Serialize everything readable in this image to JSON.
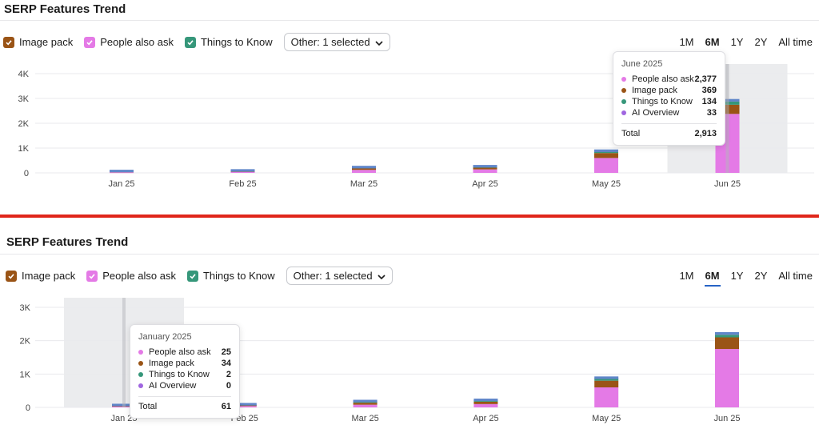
{
  "colors": {
    "image_pack": "#9a5416",
    "people_also_ask": "#e47ae6",
    "things_to_know": "#36977a",
    "ai_overview": "#a066e0",
    "top_cap": "#5f86c9",
    "highlight": "#ebecee",
    "grid": "#e9eaed",
    "active_range": "#2764c6",
    "divider": "#e0261a"
  },
  "panels": [
    {
      "title": "SERP Features Trend",
      "legend": [
        {
          "label": "Image pack",
          "color": "#9a5416",
          "checked": true
        },
        {
          "label": "People also ask",
          "color": "#e47ae6",
          "checked": true
        },
        {
          "label": "Things to Know",
          "color": "#36977a",
          "checked": true
        }
      ],
      "dropdown_label": "Other: 1 selected",
      "ranges": [
        "1M",
        "6M",
        "1Y",
        "2Y",
        "All time"
      ],
      "active_range": "6M",
      "tooltip": {
        "title": "June 2025",
        "rows": [
          {
            "label": "People also ask",
            "value": "2,377",
            "color": "#e47ae6"
          },
          {
            "label": "Image pack",
            "value": "369",
            "color": "#9a5416"
          },
          {
            "label": "Things to Know",
            "value": "134",
            "color": "#36977a"
          },
          {
            "label": "AI Overview",
            "value": "33",
            "color": "#a066e0"
          }
        ],
        "total_label": "Total",
        "total_value": "2,913"
      }
    },
    {
      "title": "SERP Features Trend",
      "legend": [
        {
          "label": "Image pack",
          "color": "#9a5416",
          "checked": true
        },
        {
          "label": "People also ask",
          "color": "#e47ae6",
          "checked": true
        },
        {
          "label": "Things to Know",
          "color": "#36977a",
          "checked": true
        }
      ],
      "dropdown_label": "Other: 1 selected",
      "ranges": [
        "1M",
        "6M",
        "1Y",
        "2Y",
        "All time"
      ],
      "active_range": "6M",
      "tooltip": {
        "title": "January 2025",
        "rows": [
          {
            "label": "People also ask",
            "value": "25",
            "color": "#e47ae6"
          },
          {
            "label": "Image pack",
            "value": "34",
            "color": "#9a5416"
          },
          {
            "label": "Things to Know",
            "value": "2",
            "color": "#36977a"
          },
          {
            "label": "AI Overview",
            "value": "0",
            "color": "#a066e0"
          }
        ],
        "total_label": "Total",
        "total_value": "61"
      }
    }
  ],
  "chart_data": [
    {
      "type": "bar",
      "stacked": true,
      "title": "SERP Features Trend",
      "categories": [
        "Jan 25",
        "Feb 25",
        "Mar 25",
        "Apr 25",
        "May 25",
        "Jun 25"
      ],
      "y_ticks": [
        "0",
        "1K",
        "2K",
        "3K",
        "4K"
      ],
      "ylim": [
        0,
        4000
      ],
      "grid": true,
      "highlighted_category": "Jun 25",
      "series": [
        {
          "name": "People also ask",
          "values": [
            25,
            40,
            120,
            140,
            600,
            2377
          ]
        },
        {
          "name": "Image pack",
          "values": [
            34,
            30,
            60,
            70,
            200,
            369
          ]
        },
        {
          "name": "Things to Know",
          "values": [
            2,
            10,
            30,
            30,
            60,
            134
          ]
        },
        {
          "name": "AI Overview",
          "values": [
            0,
            5,
            10,
            15,
            20,
            33
          ]
        }
      ]
    },
    {
      "type": "bar",
      "stacked": true,
      "title": "SERP Features Trend",
      "categories": [
        "Jan 25",
        "Feb 25",
        "Mar 25",
        "Apr 25",
        "May 25",
        "Jun 25"
      ],
      "y_ticks": [
        "0",
        "1K",
        "2K",
        "3K"
      ],
      "ylim": [
        0,
        3000
      ],
      "grid": true,
      "highlighted_category": "Jan 25",
      "series": [
        {
          "name": "People also ask",
          "values": [
            25,
            40,
            80,
            100,
            600,
            1750
          ]
        },
        {
          "name": "Image pack",
          "values": [
            34,
            30,
            60,
            70,
            200,
            350
          ]
        },
        {
          "name": "Things to Know",
          "values": [
            2,
            10,
            30,
            30,
            60,
            80
          ]
        },
        {
          "name": "AI Overview",
          "values": [
            0,
            5,
            10,
            15,
            20,
            30
          ]
        }
      ]
    }
  ]
}
